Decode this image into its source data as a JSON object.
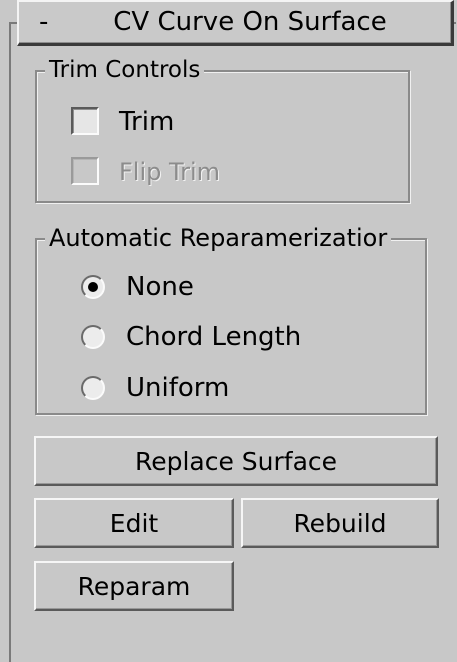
{
  "rollout": {
    "collapse_symbol": "-",
    "title": "CV Curve On Surface"
  },
  "trim_controls": {
    "label": "Trim Controls",
    "trim": {
      "label": "Trim",
      "checked": false,
      "enabled": true
    },
    "flip_trim": {
      "label": "Flip Trim",
      "checked": false,
      "enabled": false
    }
  },
  "reparameterization": {
    "label": "Automatic Reparamerizatior",
    "options": [
      {
        "label": "None",
        "selected": true
      },
      {
        "label": "Chord Length",
        "selected": false
      },
      {
        "label": "Uniform",
        "selected": false
      }
    ]
  },
  "buttons": {
    "replace_surface": "Replace Surface",
    "edit": "Edit",
    "rebuild": "Rebuild",
    "reparam": "Reparam"
  }
}
